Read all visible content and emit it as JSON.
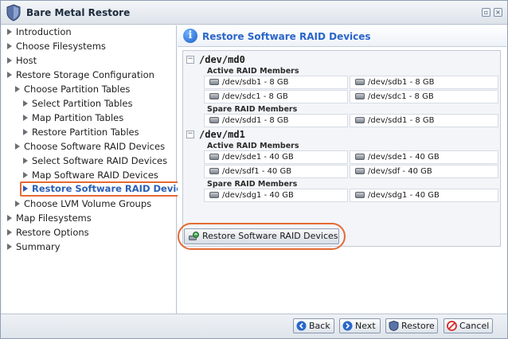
{
  "window": {
    "title": "Bare Metal Restore"
  },
  "sidebar": {
    "items": [
      {
        "label": "Introduction",
        "level": 0
      },
      {
        "label": "Choose Filesystems",
        "level": 0
      },
      {
        "label": "Host",
        "level": 0
      },
      {
        "label": "Restore Storage Configuration",
        "level": 0
      },
      {
        "label": "Choose Partition Tables",
        "level": 1
      },
      {
        "label": "Select Partition Tables",
        "level": 2
      },
      {
        "label": "Map Partition Tables",
        "level": 2
      },
      {
        "label": "Restore Partition Tables",
        "level": 2
      },
      {
        "label": "Choose Software RAID Devices",
        "level": 1
      },
      {
        "label": "Select Software RAID Devices",
        "level": 2
      },
      {
        "label": "Map Software RAID Devices",
        "level": 2
      },
      {
        "label": "Restore Software RAID Devices",
        "level": 2,
        "active": true
      },
      {
        "label": "Choose LVM Volume Groups",
        "level": 1
      },
      {
        "label": "Map Filesystems",
        "level": 0
      },
      {
        "label": "Restore Options",
        "level": 0
      },
      {
        "label": "Summary",
        "level": 0
      }
    ]
  },
  "main": {
    "title": "Restore Software RAID Devices",
    "devices": [
      {
        "name": "/dev/md0",
        "toggle": "−",
        "active_label": "Active RAID Members",
        "active": [
          "/dev/sdb1 - 8 GB",
          "/dev/sdb1 - 8 GB",
          "/dev/sdc1 - 8 GB",
          "/dev/sdc1 - 8 GB"
        ],
        "spare_label": "Spare RAID Members",
        "spare": [
          "/dev/sdd1 - 8 GB",
          "/dev/sdd1 - 8 GB"
        ]
      },
      {
        "name": "/dev/md1",
        "toggle": "−",
        "active_label": "Active RAID Members",
        "active": [
          "/dev/sde1 - 40 GB",
          "/dev/sde1 - 40 GB",
          "/dev/sdf1 - 40 GB",
          "/dev/sdf - 40 GB"
        ],
        "spare_label": "Spare RAID Members",
        "spare": [
          "/dev/sdg1 - 40 GB",
          "/dev/sdg1 - 40 GB"
        ]
      }
    ],
    "restore_button": "Restore Software RAID Devices"
  },
  "footer": {
    "back": "Back",
    "next": "Next",
    "restore": "Restore",
    "cancel": "Cancel"
  },
  "colors": {
    "accent": "#2a66c9",
    "highlight": "#e46a33"
  },
  "icons": {
    "title": "shield-icon",
    "header": "info-icon",
    "member": "disk-icon",
    "restore": "raid-restore-icon",
    "back": "back-arrow-icon",
    "next": "next-arrow-icon",
    "footer_restore": "shield-icon",
    "cancel": "cancel-icon"
  }
}
